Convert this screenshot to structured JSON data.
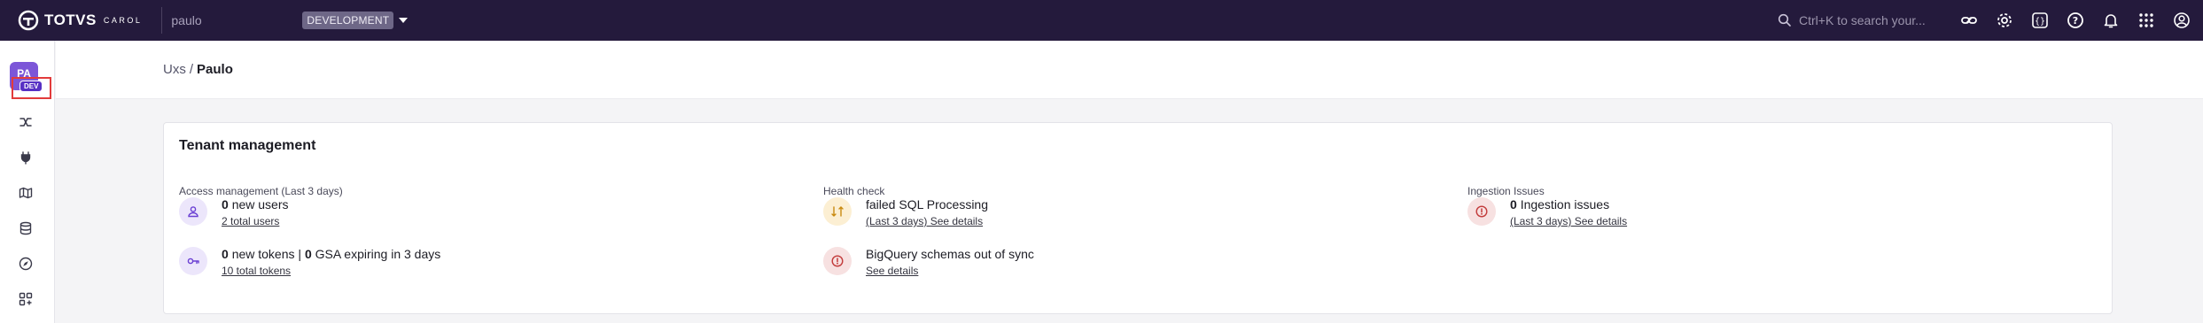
{
  "topbar": {
    "logo_text": "TOTVS",
    "logo_sub": "CAROL",
    "tenant": "paulo",
    "environment": "DEVELOPMENT",
    "search_placeholder": "Ctrl+K to search your..."
  },
  "sidebar": {
    "avatar_initials": "PA",
    "avatar_badge": "DEV",
    "icons": [
      "connectors-icon",
      "plug-icon",
      "map-icon",
      "database-icon",
      "compass-icon",
      "apps-icon"
    ]
  },
  "breadcrumb": {
    "parent": "Uxs",
    "separator": "/",
    "current": "Paulo"
  },
  "card": {
    "title": "Tenant management",
    "access": {
      "title": "Access management (Last 3 days)",
      "users_count": "0",
      "users_text": "new users",
      "users_link": "2 total users",
      "tokens_count": "0",
      "tokens_text": "new tokens",
      "tokens_sep": "|",
      "gsa_count": "0",
      "gsa_text": "GSA expiring in 3 days",
      "tokens_link": "10 total tokens"
    },
    "health": {
      "title": "Health check",
      "sql_text": "failed SQL Processing",
      "sql_link": "(Last 3 days) See details",
      "bq_text": "BigQuery schemas out of sync",
      "bq_link": "See details"
    },
    "ingestion": {
      "title": "Ingestion Issues",
      "count": "0",
      "text": "Ingestion issues",
      "link": "(Last 3 days) See details"
    }
  },
  "colors": {
    "topbar_bg": "#241a3c",
    "avatar": "#7c56d8",
    "highlight": "#e23b3b"
  }
}
